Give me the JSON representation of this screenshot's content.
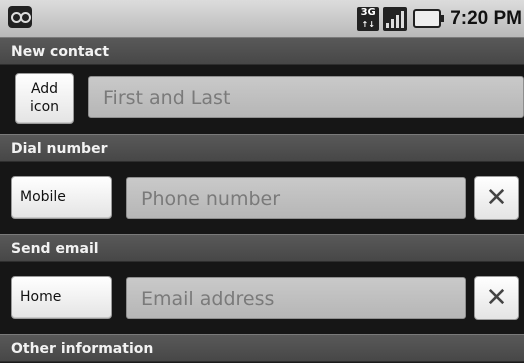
{
  "status_bar": {
    "time": "7:20 PM",
    "network_label": "3G",
    "network_arrows": "↑↓",
    "icons": [
      "app-icon",
      "3g-icon",
      "signal-icon",
      "battery-icon"
    ]
  },
  "sections": {
    "new_contact": {
      "title": "New contact",
      "add_icon_label": "Add\nicon",
      "name_placeholder": "First and Last"
    },
    "dial_number": {
      "title": "Dial number",
      "type_label": "Mobile",
      "phone_placeholder": "Phone number",
      "remove_symbol": "✕"
    },
    "send_email": {
      "title": "Send email",
      "type_label": "Home",
      "email_placeholder": "Email address",
      "remove_symbol": "✕"
    },
    "other_information": {
      "title": "Other information"
    }
  }
}
